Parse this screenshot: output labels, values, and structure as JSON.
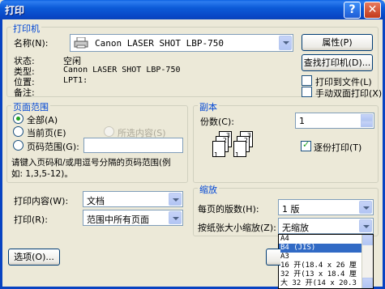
{
  "window": {
    "title": "打印"
  },
  "printer": {
    "group_label": "打印机",
    "name_label": "名称(N):",
    "name_value": "Canon LASER SHOT LBP-750",
    "properties_button": "属性(P)",
    "find_button": "查找打印机(D)...",
    "status_label": "状态:",
    "status_value": "空闲",
    "type_label": "类型:",
    "type_value": "Canon LASER SHOT LBP-750",
    "location_label": "位置:",
    "location_value": "LPT1:",
    "comment_label": "备注:",
    "print_to_file": "打印到文件(L)",
    "manual_duplex": "手动双面打印(X)"
  },
  "page_range": {
    "group_label": "页面范围",
    "all": "全部(A)",
    "current": "当前页(E)",
    "selection": "所选内容(S)",
    "pages": "页码范围(G):",
    "hint_line1": "请键入页码和/或用逗号分隔的页码范围(例",
    "hint_line2": "如: 1,3,5-12)。"
  },
  "copies": {
    "group_label": "副本",
    "count_label": "份数(C):",
    "count_value": "1",
    "collate": "逐份打印(T)"
  },
  "print_what": {
    "label": "打印内容(W):",
    "value": "文档"
  },
  "print_range": {
    "label": "打印(R):",
    "value": "范围中所有页面"
  },
  "zoom": {
    "group_label": "缩放",
    "pages_per_sheet_label": "每页的版数(H):",
    "pages_per_sheet_value": "1 版",
    "scale_label": "按纸张大小缩放(Z):",
    "scale_value": "无缩放",
    "options": [
      "A4",
      "B4 (JIS)",
      "A3",
      "16 开(18.4 x 26 厘",
      "32 开(13 x 18.4 厘",
      "大 32 开(14 x 20.3"
    ]
  },
  "options_button": "选项(O)..."
}
